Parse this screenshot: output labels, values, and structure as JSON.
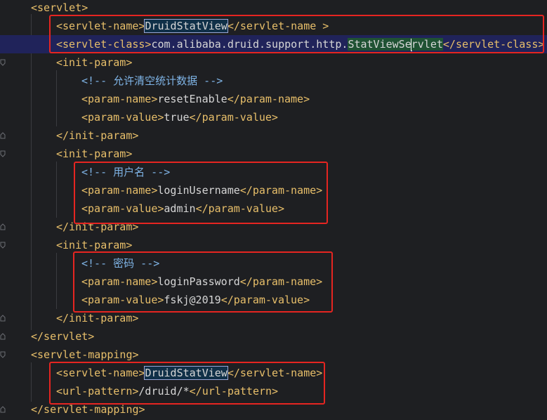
{
  "editor": {
    "lines": [
      {
        "indent": 1,
        "parts": [
          {
            "c": "tag",
            "t": "<servlet>"
          }
        ]
      },
      {
        "indent": 2,
        "parts": [
          {
            "c": "tag",
            "t": "<servlet-name>"
          },
          {
            "c": "sel",
            "t": "DruidStatView"
          },
          {
            "c": "tag",
            "t": "</servlet-name >"
          }
        ]
      },
      {
        "indent": 2,
        "parts": [
          {
            "c": "tag",
            "t": "<servlet-class>"
          },
          {
            "c": "txt",
            "t": "com.alibaba.druid.support.http."
          },
          {
            "c": "green",
            "t": "StatViewSe"
          },
          {
            "c": "caret",
            "t": ""
          },
          {
            "c": "green",
            "t": "rvlet"
          },
          {
            "c": "tag",
            "t": "</servlet-class>"
          }
        ]
      },
      {
        "indent": 2,
        "parts": [
          {
            "c": "tag",
            "t": "<init-param>"
          }
        ]
      },
      {
        "indent": 3,
        "parts": [
          {
            "c": "cmt",
            "t": "<!-- 允许清空统计数据 -->"
          }
        ]
      },
      {
        "indent": 3,
        "parts": [
          {
            "c": "tag",
            "t": "<param-name>"
          },
          {
            "c": "txt",
            "t": "resetEnable"
          },
          {
            "c": "tag",
            "t": "</param-name>"
          }
        ]
      },
      {
        "indent": 3,
        "parts": [
          {
            "c": "tag",
            "t": "<param-value>"
          },
          {
            "c": "txt",
            "t": "true"
          },
          {
            "c": "tag",
            "t": "</param-value>"
          }
        ]
      },
      {
        "indent": 2,
        "parts": [
          {
            "c": "tag",
            "t": "</init-param>"
          }
        ]
      },
      {
        "indent": 2,
        "parts": [
          {
            "c": "tag",
            "t": "<init-param>"
          }
        ]
      },
      {
        "indent": 3,
        "parts": [
          {
            "c": "cmt",
            "t": "<!-- 用户名 -->"
          }
        ]
      },
      {
        "indent": 3,
        "parts": [
          {
            "c": "tag",
            "t": "<param-name>"
          },
          {
            "c": "txt",
            "t": "loginUsername"
          },
          {
            "c": "tag",
            "t": "</param-name>"
          }
        ]
      },
      {
        "indent": 3,
        "parts": [
          {
            "c": "tag",
            "t": "<param-value>"
          },
          {
            "c": "txt",
            "t": "admin"
          },
          {
            "c": "tag",
            "t": "</param-value>"
          }
        ]
      },
      {
        "indent": 2,
        "parts": [
          {
            "c": "tag",
            "t": "</init-param>"
          }
        ]
      },
      {
        "indent": 2,
        "parts": [
          {
            "c": "tag",
            "t": "<init-param>"
          }
        ]
      },
      {
        "indent": 3,
        "parts": [
          {
            "c": "cmt",
            "t": "<!-- 密码 -->"
          }
        ]
      },
      {
        "indent": 3,
        "parts": [
          {
            "c": "tag",
            "t": "<param-name>"
          },
          {
            "c": "txt",
            "t": "loginPassword"
          },
          {
            "c": "tag",
            "t": "</param-name>"
          }
        ]
      },
      {
        "indent": 3,
        "parts": [
          {
            "c": "tag",
            "t": "<param-value>"
          },
          {
            "c": "txt",
            "t": "fskj@2019"
          },
          {
            "c": "tag",
            "t": "</param-value>"
          }
        ]
      },
      {
        "indent": 2,
        "parts": [
          {
            "c": "tag",
            "t": "</init-param>"
          }
        ]
      },
      {
        "indent": 1,
        "parts": [
          {
            "c": "tag",
            "t": "</servlet>"
          }
        ]
      },
      {
        "indent": 1,
        "parts": [
          {
            "c": "tag",
            "t": "<servlet-mapping>"
          }
        ]
      },
      {
        "indent": 2,
        "parts": [
          {
            "c": "tag",
            "t": "<servlet-name>"
          },
          {
            "c": "sel",
            "t": "DruidStatView"
          },
          {
            "c": "tag",
            "t": "</servlet-name>"
          }
        ]
      },
      {
        "indent": 2,
        "parts": [
          {
            "c": "tag",
            "t": "<url-pattern>"
          },
          {
            "c": "txt",
            "t": "/druid/*"
          },
          {
            "c": "tag",
            "t": "</url-pattern>"
          }
        ]
      },
      {
        "indent": 1,
        "parts": [
          {
            "c": "tag",
            "t": "</servlet-mapping>"
          }
        ]
      }
    ],
    "highlighted_line": 2,
    "gutter_icon": "lightbulb-icon",
    "colors": {
      "background": "#1e1f22",
      "tag": "#e8bf6a",
      "text": "#d6d6d6",
      "comment": "#7fb4e6",
      "highlight_line": "#20235a",
      "annotation_box": "#e52521"
    }
  }
}
